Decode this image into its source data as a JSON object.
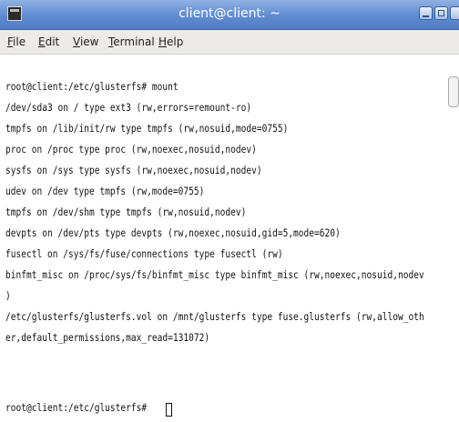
{
  "window": {
    "title": "client@client: ~"
  },
  "menu": [
    {
      "label": "File",
      "key": "F",
      "rest": "ile"
    },
    {
      "label": "Edit",
      "key": "E",
      "rest": "dit"
    },
    {
      "label": "View",
      "key": "V",
      "rest": "iew"
    },
    {
      "label": "Terminal",
      "key": "T",
      "rest": "erminal"
    },
    {
      "label": "Help",
      "key": "H",
      "rest": "elp"
    }
  ],
  "terminal": {
    "lines": [
      "root@client:/etc/glusterfs# mount",
      "/dev/sda3 on / type ext3 (rw,errors=remount-ro)",
      "tmpfs on /lib/init/rw type tmpfs (rw,nosuid,mode=0755)",
      "proc on /proc type proc (rw,noexec,nosuid,nodev)",
      "sysfs on /sys type sysfs (rw,noexec,nosuid,nodev)",
      "udev on /dev type tmpfs (rw,mode=0755)",
      "tmpfs on /dev/shm type tmpfs (rw,nosuid,nodev)",
      "devpts on /dev/pts type devpts (rw,noexec,nosuid,gid=5,mode=620)",
      "fusectl on /sys/fs/fuse/connections type fusectl (rw)",
      "binfmt_misc on /proc/sys/fs/binfmt_misc type binfmt_misc (rw,noexec,nosuid,nodev",
      ")",
      "/etc/glusterfs/glusterfs.vol on /mnt/glusterfs type fuse.glusterfs (rw,allow_oth",
      "er,default_permissions,max_read=131072)",
      "root@client:/etc/glusterfs# "
    ]
  },
  "icons": {
    "window": "terminal-icon",
    "minimize": "minimize-icon",
    "maximize": "maximize-icon",
    "close": "close-icon"
  }
}
